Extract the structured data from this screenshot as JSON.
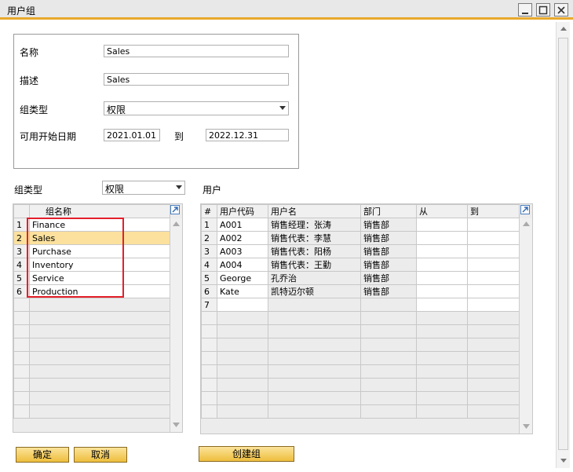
{
  "window": {
    "title": "用户组"
  },
  "header": {
    "name_label": "名称",
    "name_value": "Sales",
    "desc_label": "描述",
    "desc_value": "Sales",
    "type_label": "组类型",
    "type_value": "权限",
    "date_label": "可用开始日期",
    "date_from": "2021.01.01",
    "to_label": "到",
    "date_to": "2022.12.31"
  },
  "groups": {
    "type_label": "组类型",
    "type_value": "权限",
    "column": "组名称",
    "rows": [
      {
        "n": "1",
        "name": "Finance"
      },
      {
        "n": "2",
        "name": "Sales"
      },
      {
        "n": "3",
        "name": "Purchase"
      },
      {
        "n": "4",
        "name": "Inventory"
      },
      {
        "n": "5",
        "name": "Service"
      },
      {
        "n": "6",
        "name": "Production"
      }
    ],
    "selected_row": "2"
  },
  "users": {
    "title": "用户",
    "columns": [
      "#",
      "用户代码",
      "用户名",
      "部门",
      "从",
      "到"
    ],
    "rows": [
      {
        "n": "1",
        "code": "A001",
        "name": "销售经理：张涛",
        "dept": "销售部"
      },
      {
        "n": "2",
        "code": "A002",
        "name": "销售代表：李慧",
        "dept": "销售部"
      },
      {
        "n": "3",
        "code": "A003",
        "name": "销售代表：阳杨",
        "dept": "销售部"
      },
      {
        "n": "4",
        "code": "A004",
        "name": "销售代表：王勤",
        "dept": "销售部"
      },
      {
        "n": "5",
        "code": "George",
        "name": "孔乔治",
        "dept": "销售部"
      },
      {
        "n": "6",
        "code": "Kate",
        "name": "凯特迈尔顿",
        "dept": "销售部"
      },
      {
        "n": "7",
        "code": "",
        "name": "",
        "dept": ""
      }
    ]
  },
  "buttons": {
    "ok": "确定",
    "cancel": "取消",
    "create_group": "创建组"
  },
  "icons": {
    "dropdown": "chevron-down-icon",
    "expand": "expand-arrow-icon",
    "minimize": "minimize-icon",
    "maximize": "maximize-icon",
    "close": "close-icon"
  },
  "colors": {
    "accent": "#e8a92b",
    "selected_row": "#fbe19d",
    "highlight_box": "#e3202a",
    "button": "#f4cb5a"
  }
}
